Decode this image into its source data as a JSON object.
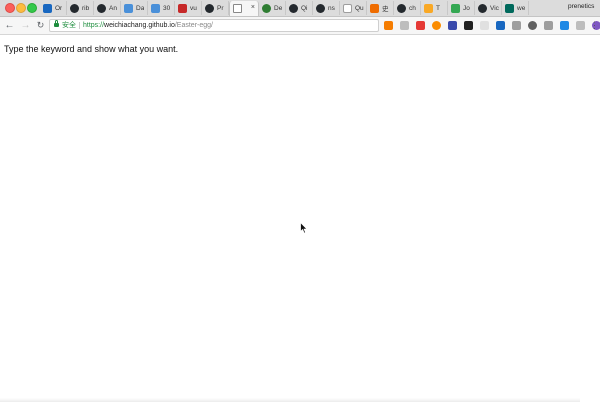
{
  "window": {
    "profile_name": "prenetics",
    "tabs": [
      {
        "label": "Or",
        "icon": "vuetify-icon",
        "color": "#1867c0",
        "glyph": "V"
      },
      {
        "label": "rib",
        "icon": "github-icon",
        "color": "#24292e",
        "glyph": ""
      },
      {
        "label": "An",
        "icon": "github-icon",
        "color": "#24292e",
        "glyph": ""
      },
      {
        "label": "Da",
        "icon": "blue-square-icon",
        "color": "#4a90d9",
        "glyph": ""
      },
      {
        "label": "30",
        "icon": "blue-square-icon",
        "color": "#4a90d9",
        "glyph": ""
      },
      {
        "label": "vu",
        "icon": "red-square-icon",
        "color": "#c62828",
        "glyph": ""
      },
      {
        "label": "Pr",
        "icon": "github-icon",
        "color": "#24292e",
        "glyph": ""
      },
      {
        "label": "",
        "icon": "blank-page-icon",
        "color": "#ffffff",
        "glyph": "",
        "active": true
      },
      {
        "label": "De",
        "icon": "green-circle-icon",
        "color": "#2e7d32",
        "glyph": ""
      },
      {
        "label": "Qi",
        "icon": "github-icon",
        "color": "#24292e",
        "glyph": ""
      },
      {
        "label": "ns",
        "icon": "github-icon",
        "color": "#24292e",
        "glyph": ""
      },
      {
        "label": "Qu",
        "icon": "gray-outline-icon",
        "color": "#9e9e9e",
        "glyph": ""
      },
      {
        "label": "史",
        "icon": "orange-square-icon",
        "color": "#ef6c00",
        "glyph": ""
      },
      {
        "label": "ch",
        "icon": "github-icon",
        "color": "#24292e",
        "glyph": ""
      },
      {
        "label": "T",
        "icon": "orange-square-icon",
        "color": "#f9a825",
        "glyph": ""
      },
      {
        "label": "Jo",
        "icon": "google-maps-icon",
        "color": "#34a853",
        "glyph": ""
      },
      {
        "label": "Vic",
        "icon": "github-icon",
        "color": "#24292e",
        "glyph": ""
      },
      {
        "label": "we",
        "icon": "dark-green-square-icon",
        "color": "#00695c",
        "glyph": ""
      }
    ]
  },
  "toolbar": {
    "secure_label": "安全",
    "url_scheme": "https://",
    "url_host": "weichiachang.github.io",
    "url_path": "/Easter-egg/",
    "extensions": [
      {
        "icon": "ext-orange-icon",
        "color": "#f57c00",
        "glyph": ""
      },
      {
        "icon": "ext-gray-icon",
        "color": "#bdbdbd",
        "glyph": ""
      },
      {
        "icon": "ext-red-icon",
        "color": "#e53935",
        "glyph": ""
      },
      {
        "icon": "ext-orange-round-icon",
        "color": "#fb8c00",
        "glyph": ""
      },
      {
        "icon": "ext-blue-icon",
        "color": "#3949ab",
        "glyph": ""
      },
      {
        "icon": "ext-black-icon",
        "color": "#212121",
        "glyph": ""
      },
      {
        "icon": "ext-lightgray-icon",
        "color": "#e0e0e0",
        "glyph": ""
      },
      {
        "icon": "ext-vue-icon",
        "color": "#1867c0",
        "glyph": ""
      },
      {
        "icon": "ext-question-icon",
        "color": "#9e9e9e",
        "glyph": ""
      },
      {
        "icon": "ext-a-icon",
        "color": "#616161",
        "glyph": ""
      },
      {
        "icon": "ext-square-icon",
        "color": "#9e9e9e",
        "glyph": ""
      },
      {
        "icon": "ext-blue-square-icon",
        "color": "#1e88e5",
        "glyph": ""
      },
      {
        "icon": "ext-s-icon",
        "color": "#bdbdbd",
        "glyph": ""
      },
      {
        "icon": "ext-globe-icon",
        "color": "#7e57c2",
        "glyph": ""
      }
    ]
  },
  "page": {
    "text": "Type the keyword and show what you want."
  }
}
